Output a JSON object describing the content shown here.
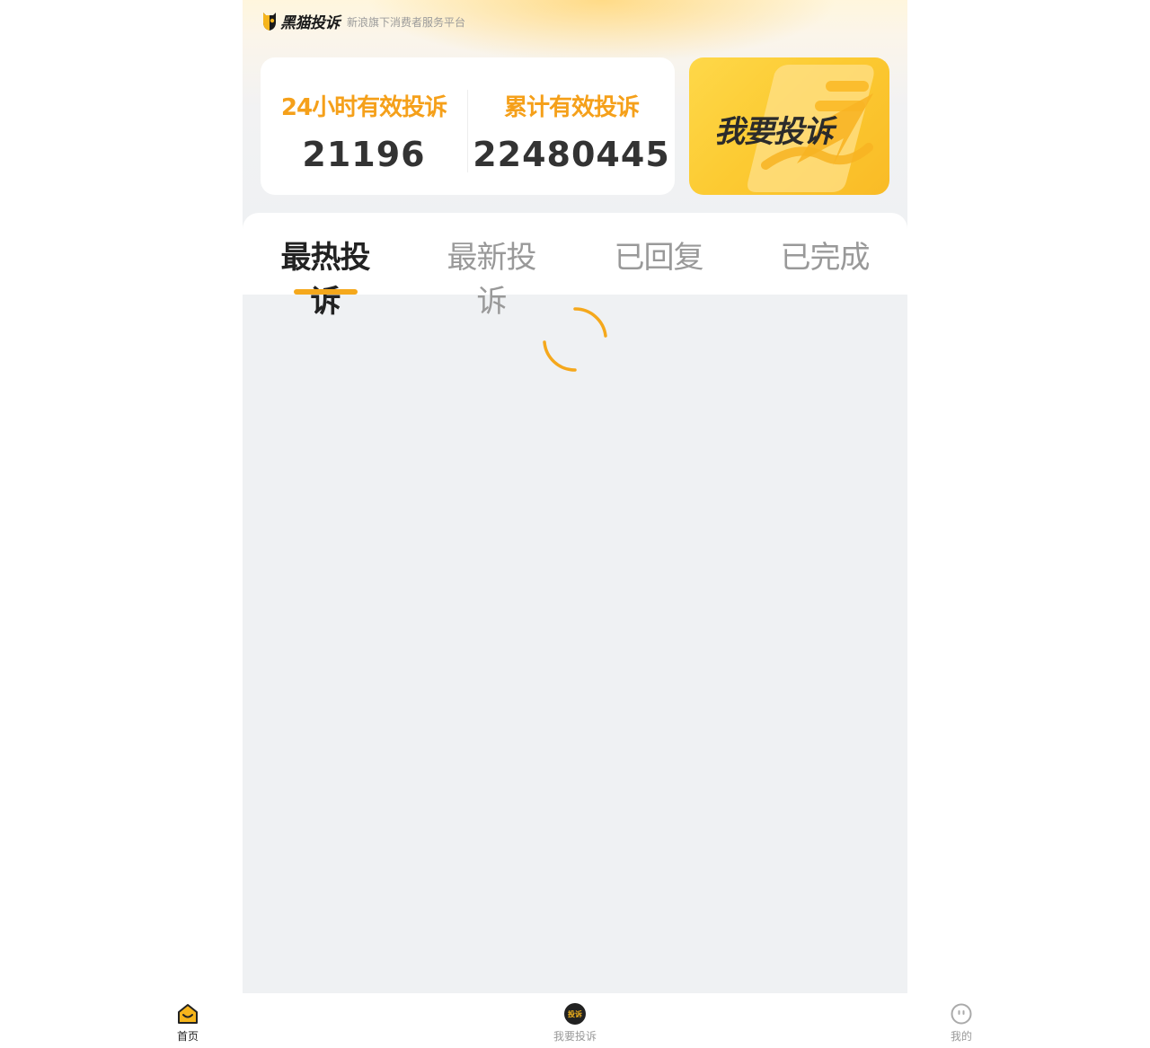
{
  "brand": {
    "name": "黑猫投诉",
    "tagline": "新浪旗下消费者服务平台"
  },
  "stats": {
    "day_label": "24小时有效投诉",
    "day_value": "21196",
    "total_label": "累计有效投诉",
    "total_value": "22480445"
  },
  "complain_button": {
    "label": "我要投诉"
  },
  "tabs": [
    {
      "label": "最热投诉",
      "active": true
    },
    {
      "label": "最新投诉",
      "active": false
    },
    {
      "label": "已回复",
      "active": false
    },
    {
      "label": "已完成",
      "active": false
    }
  ],
  "loading": {
    "icon": "loading-spinner-icon",
    "color": "#f5a81c"
  },
  "bottom_nav": [
    {
      "label": "首页",
      "icon": "home-icon",
      "active": true
    },
    {
      "label": "我要投诉",
      "icon": "complain-icon",
      "icon_text": "投诉",
      "active": false
    },
    {
      "label": "我的",
      "icon": "profile-icon",
      "active": false
    }
  ],
  "colors": {
    "accent": "#f5a01a",
    "card_yellow": "#fccb33",
    "text_dark": "#333333",
    "text_muted": "#999999",
    "page_bg": "#eff1f3"
  }
}
